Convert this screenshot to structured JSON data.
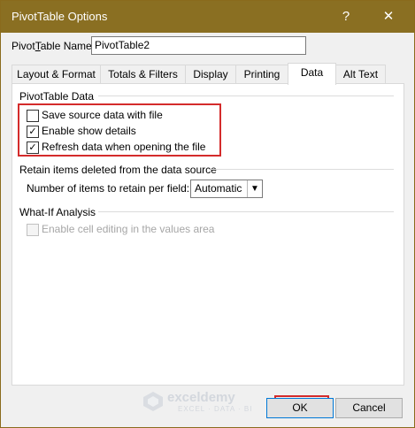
{
  "window": {
    "title": "PivotTable Options",
    "help_label": "?",
    "close_label": "✕"
  },
  "name": {
    "label": "PivotTable Name:",
    "value": "PivotTable2"
  },
  "tabs": [
    {
      "label": "Layout & Format"
    },
    {
      "label": "Totals & Filters"
    },
    {
      "label": "Display"
    },
    {
      "label": "Printing"
    },
    {
      "label": "Data"
    },
    {
      "label": "Alt Text"
    }
  ],
  "active_tab": "Data",
  "pivot_data": {
    "title": "PivotTable Data",
    "save_source": {
      "label": "Save source data with file",
      "checked": false
    },
    "enable_details": {
      "label": "Enable show details",
      "checked": true
    },
    "refresh_on_open": {
      "label": "Refresh data when opening the file",
      "checked": true
    }
  },
  "retain": {
    "title": "Retain items deleted from the data source",
    "label": "Number of items to retain per field:",
    "value": "Automatic"
  },
  "whatif": {
    "title": "What-If Analysis",
    "enable_cell_editing": {
      "label": "Enable cell editing in the values area",
      "checked": false,
      "disabled": true
    }
  },
  "buttons": {
    "ok": "OK",
    "cancel": "Cancel"
  },
  "watermark": {
    "name": "exceldemy",
    "tagline": "EXCEL · DATA · BI"
  },
  "colors": {
    "titlebar": "#8a6f22",
    "highlight": "#d42b2b"
  }
}
